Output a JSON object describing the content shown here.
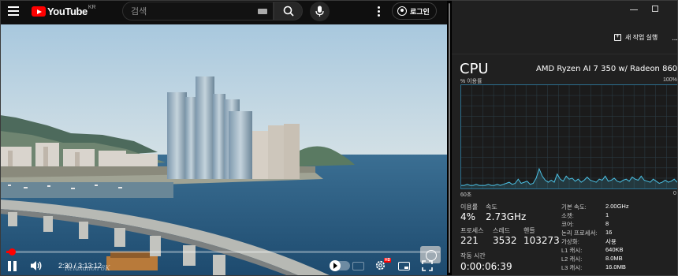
{
  "youtube": {
    "logo_text": "YouTube",
    "region": "KR",
    "search": {
      "placeholder": "검색",
      "value": ""
    },
    "login_label": "로그인",
    "channel_watermark": "Relaxation 8K",
    "player": {
      "state": "playing",
      "current_time": "2:30",
      "duration": "3:13:12",
      "time_display": "2:30 / 3:13:12",
      "progress_fraction": 0.013,
      "hd_badge": "HD",
      "accent_color": "#ff0000"
    }
  },
  "task_manager": {
    "toolbar": {
      "new_task_label": "새 작업 실행",
      "more_label": "···"
    },
    "cpu": {
      "title": "CPU",
      "model": "AMD Ryzen AI 7 350 w/ Radeon 860M",
      "util_label": "% 이용률",
      "util_max": "100%",
      "graph_window_label": "60초",
      "graph_end_label": "0",
      "line_color": "#4cc2e6"
    },
    "stats": {
      "utilization": {
        "label": "이용률",
        "value": "4%"
      },
      "speed": {
        "label": "속도",
        "value": "2.73GHz"
      },
      "processes": {
        "label": "프로세스",
        "value": "221"
      },
      "threads": {
        "label": "스레드",
        "value": "3532"
      },
      "handles": {
        "label": "핸들",
        "value": "103273"
      },
      "uptime": {
        "label": "작동 시간",
        "value": "0:00:06:39"
      }
    },
    "specs": [
      {
        "key": "기본 속도:",
        "value": "2.00GHz"
      },
      {
        "key": "소켓:",
        "value": "1"
      },
      {
        "key": "코어:",
        "value": "8"
      },
      {
        "key": "논리 프로세서:",
        "value": "16"
      },
      {
        "key": "가상화:",
        "value": "사용"
      },
      {
        "key": "L1 캐시:",
        "value": "640KB"
      },
      {
        "key": "L2 캐시:",
        "value": "8.0MB"
      },
      {
        "key": "L3 캐시:",
        "value": "16.0MB"
      }
    ],
    "cpu_history_percent": [
      3,
      3,
      4,
      3,
      3,
      4,
      3,
      3,
      3,
      4,
      3,
      3,
      4,
      3,
      4,
      5,
      6,
      4,
      5,
      9,
      5,
      6,
      7,
      4,
      5,
      10,
      19,
      12,
      8,
      6,
      8,
      6,
      14,
      9,
      7,
      12,
      9,
      10,
      7,
      9,
      6,
      8,
      11,
      8,
      7,
      6,
      9,
      8,
      12,
      7,
      8,
      10,
      7,
      6,
      8,
      9,
      7,
      11,
      9,
      8,
      12,
      8,
      7,
      6,
      9,
      7,
      5,
      6,
      8,
      6,
      7,
      9,
      6
    ]
  }
}
